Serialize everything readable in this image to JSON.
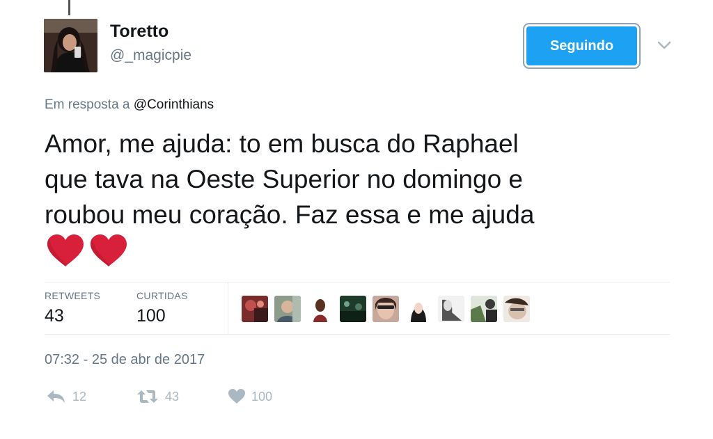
{
  "tweet": {
    "author": {
      "display_name": "Toretto",
      "username": "@_magicpie"
    },
    "follow_button_label": "Seguindo",
    "reply_context": {
      "prefix": "Em resposta a",
      "mention": "@Corinthians"
    },
    "text_lines": [
      "Amor, me ajuda: to em busca do Raphael",
      "que tava na Oeste Superior no domingo e",
      "roubou meu coração. Faz essa e me ajuda"
    ],
    "emoji": [
      "red-heart",
      "red-heart"
    ],
    "stats": {
      "retweets_label": "RETWEETS",
      "retweets_value": "43",
      "likes_label": "CURTIDAS",
      "likes_value": "100"
    },
    "timestamp": "07:32 - 25 de abr de 2017",
    "actions": {
      "reply_count": "12",
      "retweet_count": "43",
      "like_count": "100"
    }
  },
  "icons": {
    "reply": "reply-arrow-icon",
    "retweet": "retweet-icon",
    "like": "heart-icon",
    "more": "chevron-down-icon"
  },
  "colors": {
    "accent": "#1da1f2",
    "heart_emoji": "#d8203a",
    "muted_text": "#657786",
    "action_icon": "#aab8c2"
  }
}
